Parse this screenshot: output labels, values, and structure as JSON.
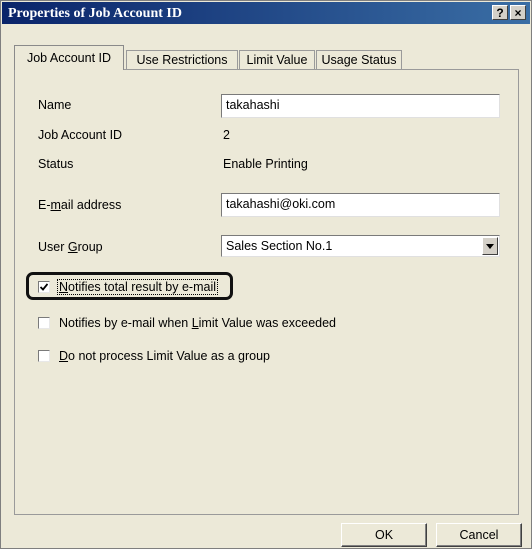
{
  "window": {
    "title": "Properties of Job Account ID",
    "help_button": "?",
    "close_button": "×"
  },
  "tabs": [
    {
      "label": "Job Account ID",
      "active": true
    },
    {
      "label": "Use Restrictions",
      "active": false
    },
    {
      "label": "Limit Value",
      "active": false
    },
    {
      "label": "Usage Status",
      "active": false
    }
  ],
  "form": {
    "name_label": "Name",
    "name_value": "takahashi",
    "job_account_id_label": "Job Account ID",
    "job_account_id_value": "2",
    "status_label": "Status",
    "status_value": "Enable Printing",
    "email_label_prefix": "E-",
    "email_label_mnemonic": "m",
    "email_label_suffix": "ail address",
    "email_value": "takahashi@oki.com",
    "user_group_label_prefix": "User ",
    "user_group_label_mnemonic": "G",
    "user_group_label_suffix": "roup",
    "user_group_value": "Sales Section No.1"
  },
  "checkboxes": {
    "notify_total": {
      "prefix": "",
      "mnemonic": "N",
      "suffix": "otifies total result by e-mail",
      "checked": true
    },
    "notify_exceeded": {
      "prefix": "Notifies by e-mail when ",
      "mnemonic": "L",
      "suffix": "imit Value was exceeded",
      "checked": false
    },
    "no_group_limit": {
      "prefix": "",
      "mnemonic": "D",
      "suffix": "o not process Limit Value as a group",
      "checked": false
    }
  },
  "buttons": {
    "ok": "OK",
    "cancel": "Cancel"
  }
}
